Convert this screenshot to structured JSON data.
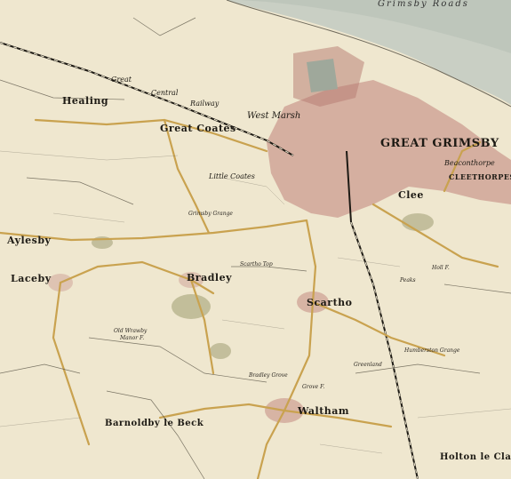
{
  "map": {
    "sea_label": "Grimsby Roads",
    "railway_labels": [
      "Great",
      "Central",
      "Railway"
    ],
    "water_color": "#c9cfc4",
    "paper_color": "#efe7cf",
    "road_color": "#c9a24f",
    "town_color": "#c0827a",
    "places": {
      "great_grimsby": "GREAT GRIMSBY",
      "cleethorpes": "CLEETHORPES",
      "beaconthorpe": "Beaconthorpe",
      "clee": "Clee",
      "west_marsh": "West Marsh",
      "scartho": "Scartho",
      "waltham": "Waltham",
      "healing": "Healing",
      "great_coates": "Great Coates",
      "little_coates": "Little Coates",
      "bradley": "Bradley",
      "aylesby": "Aylesby",
      "laceby": "Laceby",
      "barnoldby": "Barnoldby le Beck",
      "holton": "Holton le Clay",
      "grimsby_grange": "Grimsby Grange",
      "scartho_top": "Scartho Top",
      "bradley_grove": "Bradley Grove",
      "greenland": "Greenland",
      "humberston_grange": "Humberston Grange",
      "old_wrawby": "Old Wrawby",
      "manor": "Manor F.",
      "grove": "Grove F.",
      "peaks": "Peaks",
      "holl": "Holl F."
    }
  }
}
